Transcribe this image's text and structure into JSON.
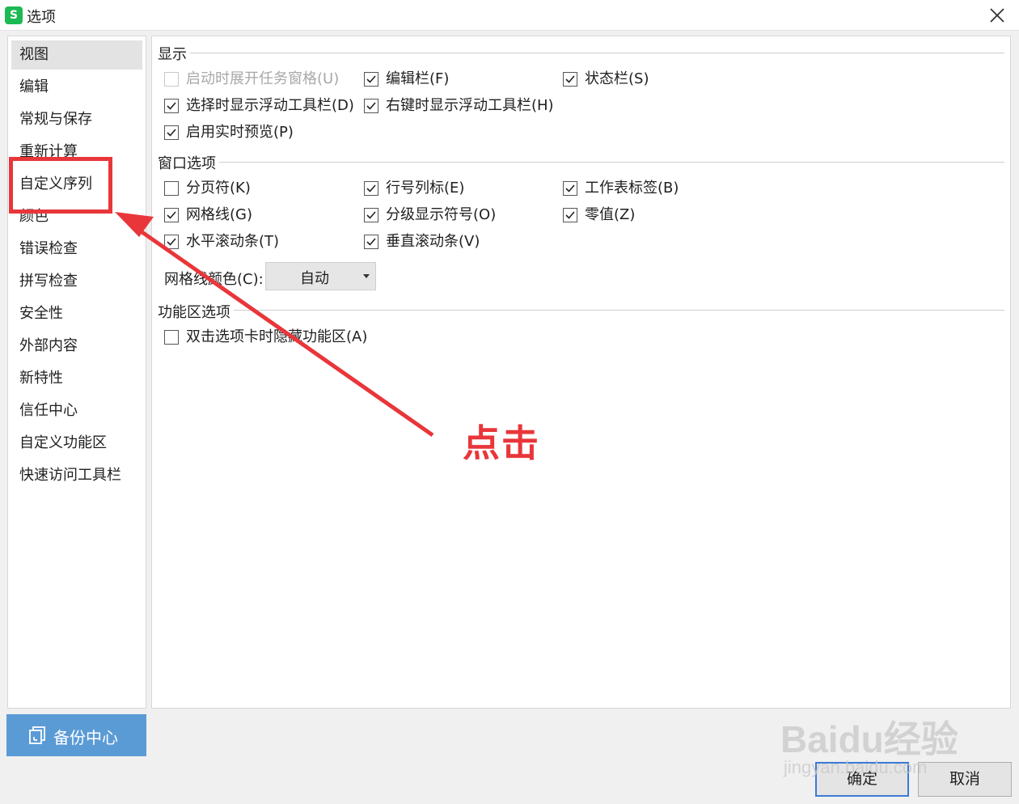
{
  "window": {
    "title": "选项",
    "app_icon_glyph": "S",
    "icons": {
      "app": "wps-spreadsheet-icon",
      "close": "close-icon"
    }
  },
  "sidebar": {
    "items": [
      {
        "label": "视图",
        "selected": true
      },
      {
        "label": "编辑"
      },
      {
        "label": "常规与保存"
      },
      {
        "label": "重新计算"
      },
      {
        "label": "自定义序列"
      },
      {
        "label": "颜色"
      },
      {
        "label": "错误检查"
      },
      {
        "label": "拼写检查"
      },
      {
        "label": "安全性"
      },
      {
        "label": "外部内容"
      },
      {
        "label": "新特性"
      },
      {
        "label": "信任中心"
      },
      {
        "label": "自定义功能区"
      },
      {
        "label": "快速访问工具栏"
      }
    ],
    "backup_label": "备份中心",
    "backup_icon": "backup-icon",
    "backup_color": "#5b9bd5"
  },
  "display": {
    "title": "显示",
    "options": [
      {
        "label": "启动时展开任务窗格(U)",
        "checked": false,
        "disabled": true
      },
      {
        "label": "编辑栏(F)",
        "checked": true
      },
      {
        "label": "状态栏(S)",
        "checked": true
      },
      {
        "label": "选择时显示浮动工具栏(D)",
        "checked": true
      },
      {
        "label": "右键时显示浮动工具栏(H)",
        "checked": true
      },
      {
        "label": "启用实时预览(P)",
        "checked": true
      }
    ]
  },
  "window_options": {
    "title": "窗口选项",
    "options": [
      {
        "label": "分页符(K)",
        "checked": false
      },
      {
        "label": "行号列标(E)",
        "checked": true
      },
      {
        "label": "工作表标签(B)",
        "checked": true
      },
      {
        "label": "网格线(G)",
        "checked": true
      },
      {
        "label": "分级显示符号(O)",
        "checked": true
      },
      {
        "label": "零值(Z)",
        "checked": true
      },
      {
        "label": "水平滚动条(T)",
        "checked": true
      },
      {
        "label": "垂直滚动条(V)",
        "checked": true
      }
    ],
    "grid_color_label": "网格线颜色(C):",
    "grid_color_value": "自动"
  },
  "ribbon": {
    "title": "功能区选项",
    "options": [
      {
        "label": "双击选项卡时隐藏功能区(A)",
        "checked": false
      }
    ]
  },
  "footer": {
    "ok_label": "确定",
    "cancel_label": "取消",
    "ok_border_color": "#3a7bd5"
  },
  "annotation": {
    "text": "点击",
    "color": "#e8363a"
  },
  "watermark": {
    "logo": "Baidu经验",
    "url": "jingyan.baidu.com"
  }
}
